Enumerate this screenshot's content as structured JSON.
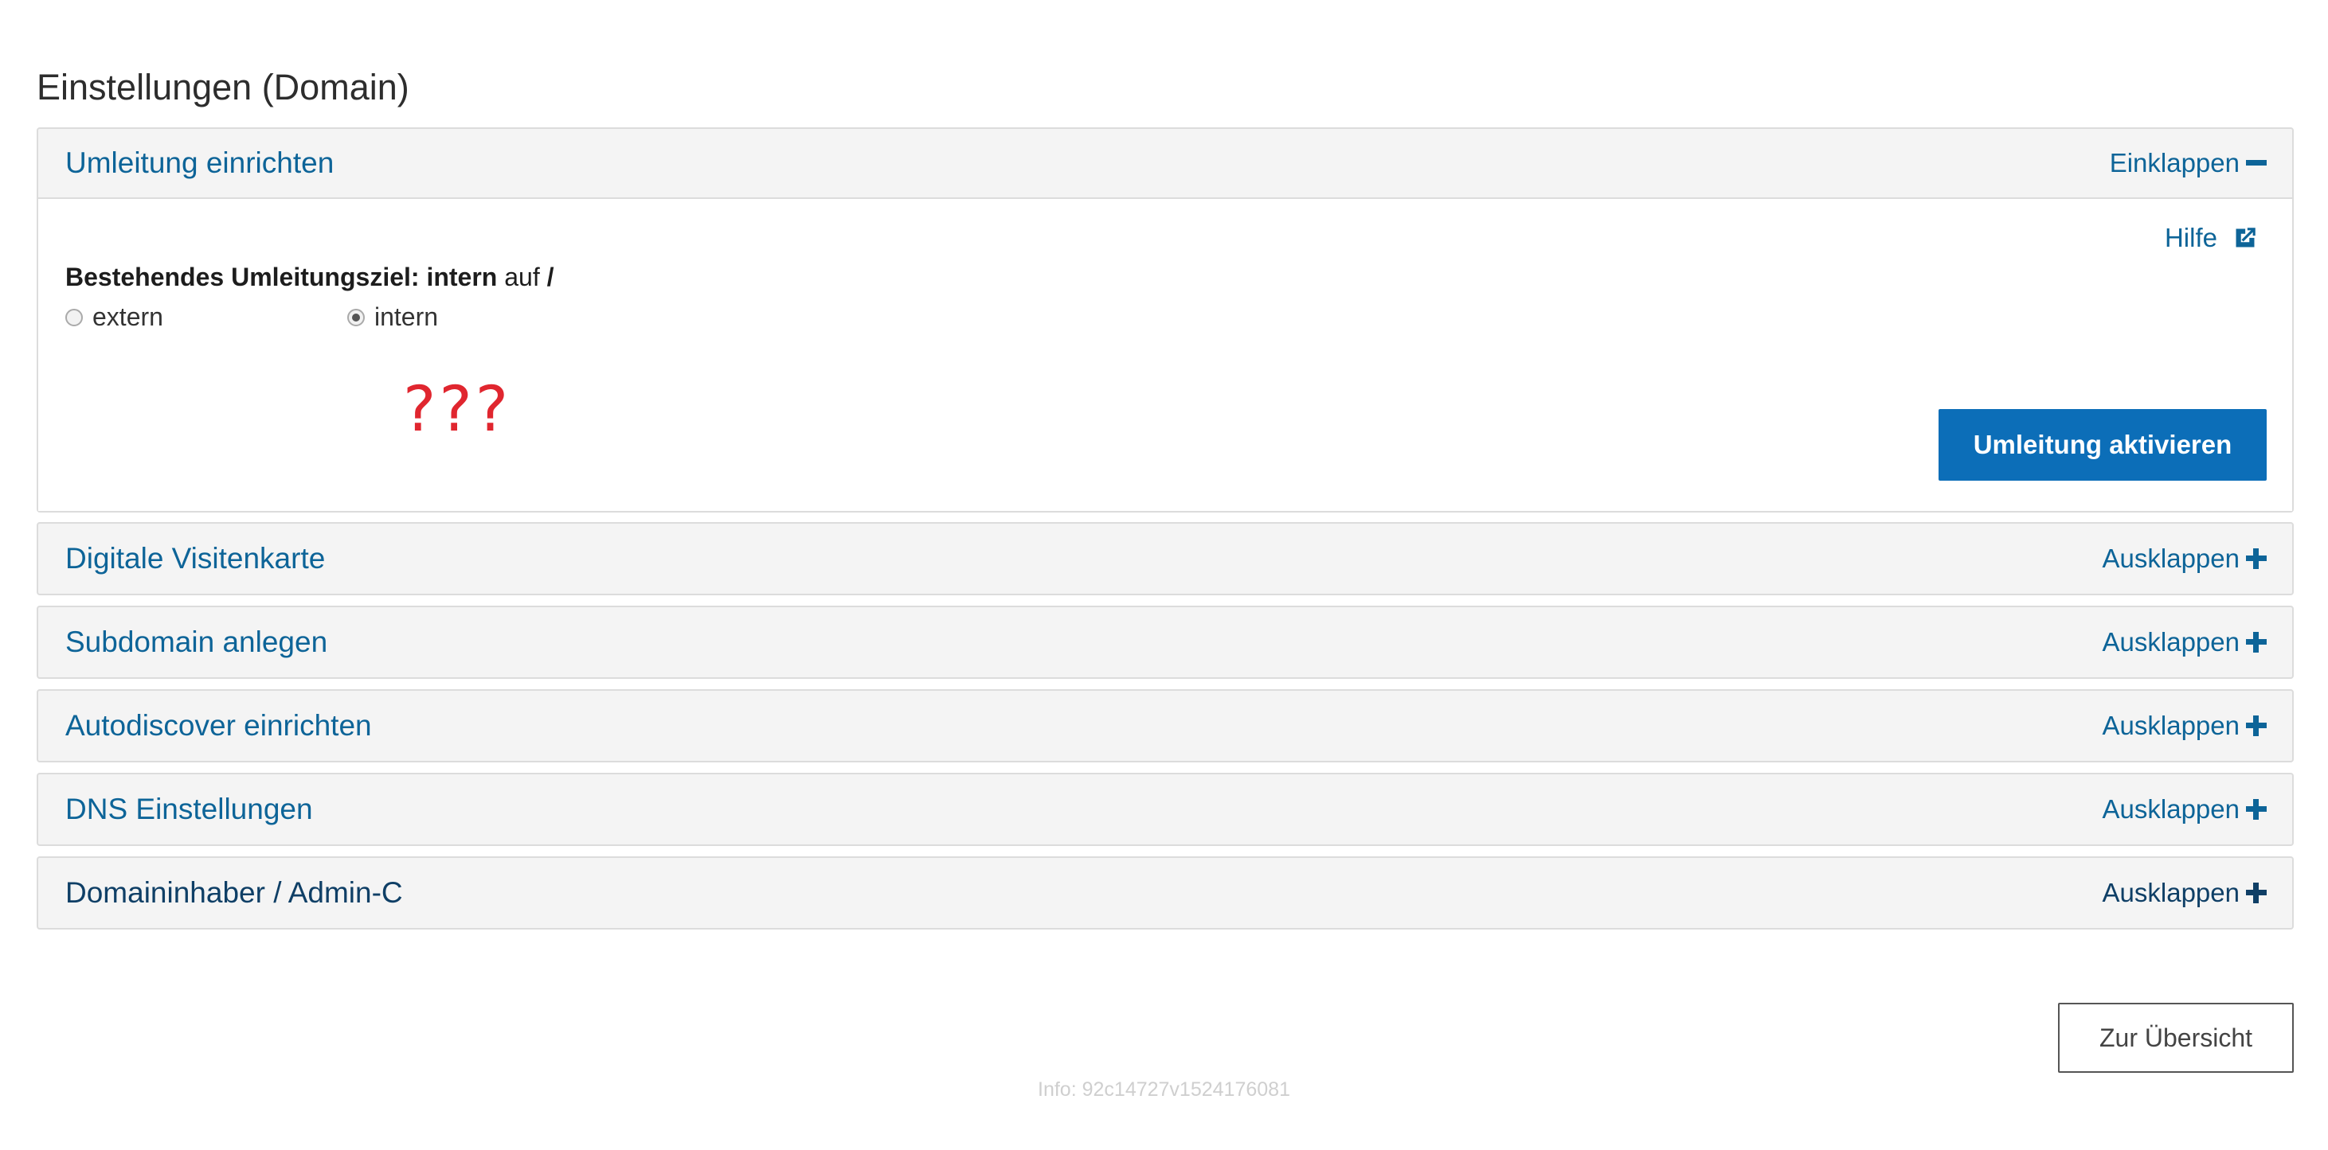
{
  "page": {
    "title": "Einstellungen (Domain)"
  },
  "sections": [
    {
      "title": "Umleitung einrichten",
      "toggle_label": "Einklappen",
      "expanded": true,
      "body": {
        "help_label": "Hilfe",
        "existing_target_label": "Bestehendes Umleitungsziel:",
        "existing_target_type": "intern",
        "existing_target_prep": "auf",
        "existing_target_path": "/",
        "radio_options": [
          {
            "label": "extern",
            "checked": false
          },
          {
            "label": "intern",
            "checked": true
          }
        ],
        "annotation": "???",
        "submit_label": "Umleitung aktivieren"
      }
    },
    {
      "title": "Digitale Visitenkarte",
      "toggle_label": "Ausklappen",
      "expanded": false
    },
    {
      "title": "Subdomain anlegen",
      "toggle_label": "Ausklappen",
      "expanded": false
    },
    {
      "title": "Autodiscover einrichten",
      "toggle_label": "Ausklappen",
      "expanded": false
    },
    {
      "title": "DNS Einstellungen",
      "toggle_label": "Ausklappen",
      "expanded": false
    },
    {
      "title": "Domaininhaber / Admin-C",
      "toggle_label": "Ausklappen",
      "expanded": false
    }
  ],
  "overview_button_label": "Zur Übersicht",
  "footer_info": "Info: 92c14727v1524176081",
  "colors": {
    "link": "#0d6498",
    "primary_button": "#0c6eb8",
    "annotation": "#e0262f"
  },
  "icons": {
    "collapse": "minus-icon",
    "expand": "plus-icon",
    "help": "external-link-icon"
  }
}
